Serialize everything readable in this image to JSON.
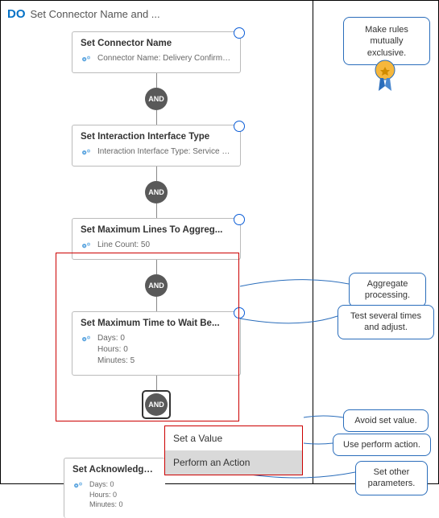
{
  "header": {
    "do": "DO",
    "title": "Set Connector Name and ..."
  },
  "operators": {
    "and": "AND"
  },
  "cards": {
    "c1": {
      "title": "Set Connector Name",
      "sub": "Connector Name: Delivery Confirmatio..."
    },
    "c2": {
      "title": "Set Interaction Interface Type",
      "sub": "Interaction Interface Type: Service Data..."
    },
    "c3": {
      "title": "Set Maximum Lines To Aggreg...",
      "sub": "Line Count: 50"
    },
    "c4": {
      "title": "Set Maximum Time to Wait Be...",
      "sub": "Days: 0\nHours: 0\nMinutes: 5"
    },
    "c5": {
      "title": "Set Acknowledgemen",
      "sub": "Days: 0\nHours: 0\nMinutes: 0"
    }
  },
  "menu": {
    "item1": "Set a Value",
    "item2": "Perform an Action"
  },
  "callouts": {
    "top": "Make rules mutually exclusive.",
    "agg": "Aggregate processing.",
    "test": "Test several times and adjust.",
    "avoid": "Avoid set value.",
    "use": "Use perform action.",
    "other": "Set other parameters."
  },
  "colors": {
    "accent": "#0572c6",
    "leader": "#2a6dbb",
    "red": "#c00",
    "node": "#595959"
  }
}
